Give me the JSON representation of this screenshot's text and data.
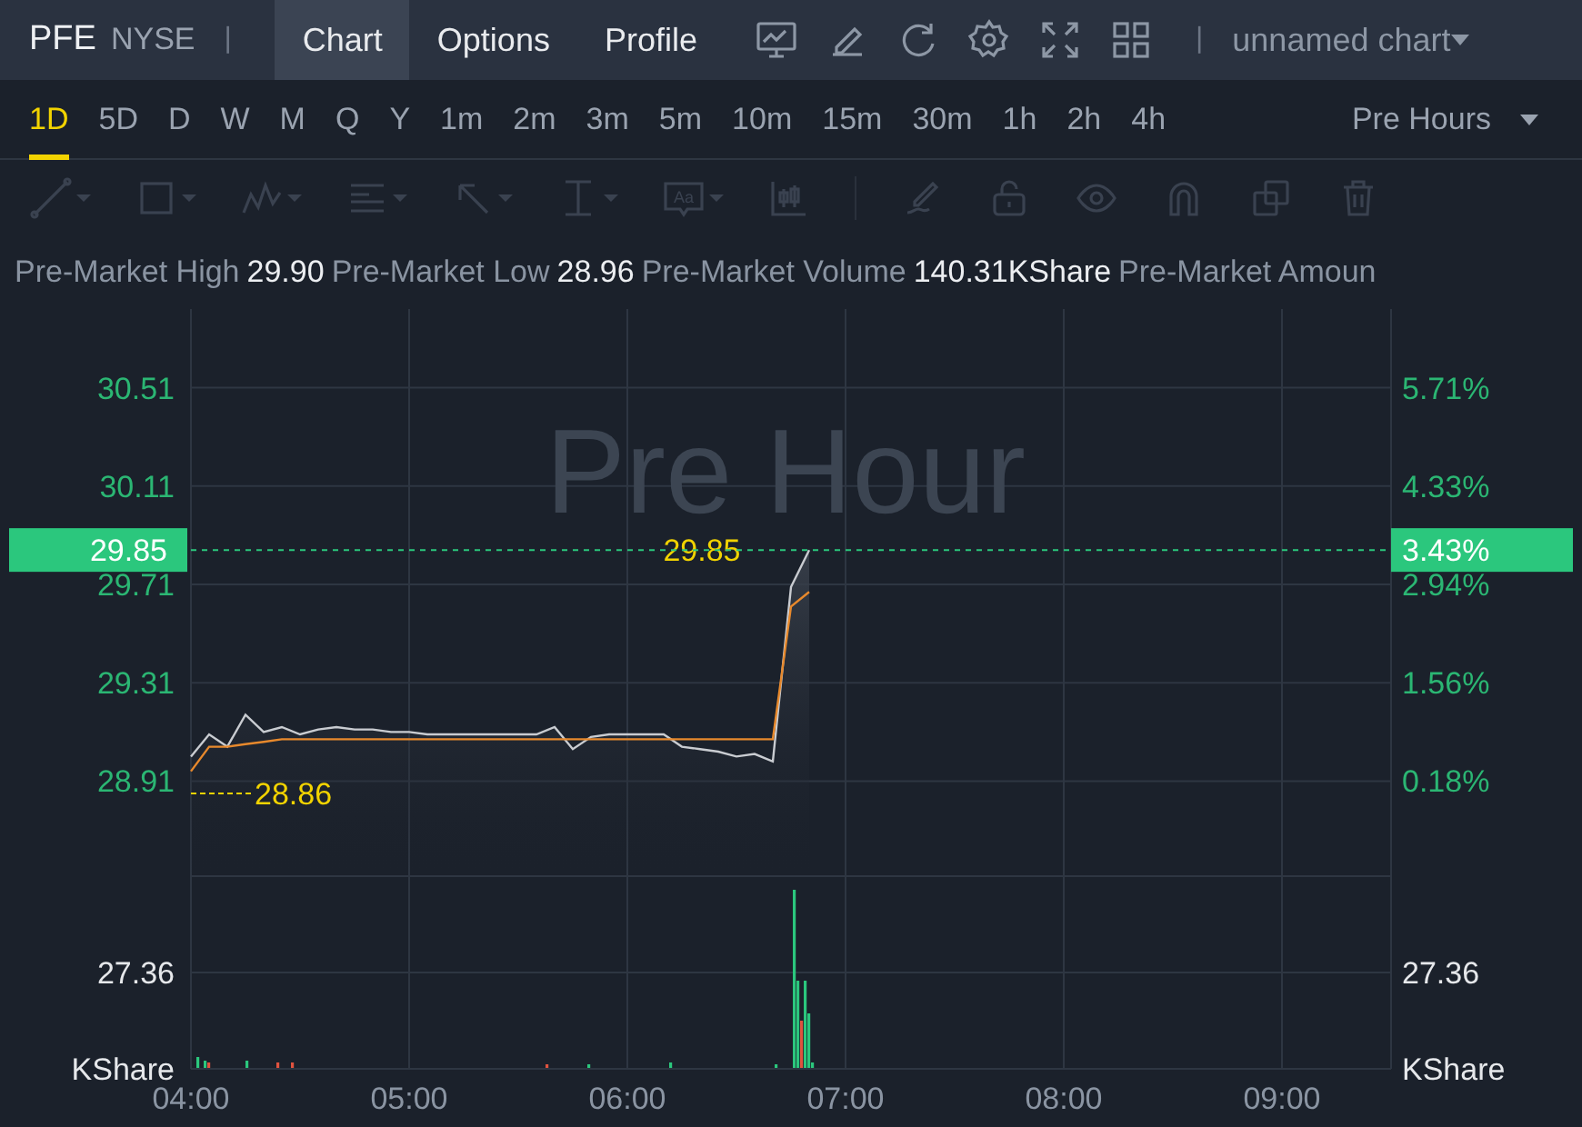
{
  "header": {
    "symbol": "PFE",
    "exchange": "NYSE",
    "separator": "|",
    "tabs": [
      {
        "label": "Chart",
        "selected": true
      },
      {
        "label": "Options",
        "selected": false
      },
      {
        "label": "Profile",
        "selected": false
      }
    ],
    "chart_name": "unnamed chart"
  },
  "timeframes": [
    {
      "label": "1D",
      "selected": true
    },
    {
      "label": "5D",
      "selected": false
    },
    {
      "label": "D",
      "selected": false
    },
    {
      "label": "W",
      "selected": false
    },
    {
      "label": "M",
      "selected": false
    },
    {
      "label": "Q",
      "selected": false
    },
    {
      "label": "Y",
      "selected": false
    },
    {
      "label": "1m",
      "selected": false
    },
    {
      "label": "2m",
      "selected": false
    },
    {
      "label": "3m",
      "selected": false
    },
    {
      "label": "5m",
      "selected": false
    },
    {
      "label": "10m",
      "selected": false
    },
    {
      "label": "15m",
      "selected": false
    },
    {
      "label": "30m",
      "selected": false
    },
    {
      "label": "1h",
      "selected": false
    },
    {
      "label": "2h",
      "selected": false
    },
    {
      "label": "4h",
      "selected": false
    }
  ],
  "session": "Pre Hours",
  "drawing_tools": [
    {
      "kind": "line",
      "disabled": true
    },
    {
      "kind": "rectangle",
      "disabled": true
    },
    {
      "kind": "pattern",
      "disabled": true
    },
    {
      "kind": "fib",
      "disabled": true
    },
    {
      "kind": "arrow",
      "disabled": true
    },
    {
      "kind": "measure",
      "disabled": true
    },
    {
      "kind": "text",
      "label": "Aa",
      "disabled": true
    },
    {
      "kind": "indicator",
      "disabled": true
    },
    {
      "kind": "pencil",
      "disabled": true
    },
    {
      "kind": "lock",
      "disabled": true
    },
    {
      "kind": "eye",
      "disabled": true
    },
    {
      "kind": "magnet",
      "disabled": true
    },
    {
      "kind": "layers",
      "disabled": true
    },
    {
      "kind": "trash",
      "disabled": true
    }
  ],
  "stats": [
    {
      "label": "Pre-Market High",
      "value": "29.90"
    },
    {
      "label": "Pre-Market Low",
      "value": "28.96"
    },
    {
      "label": "Pre-Market Volume",
      "value": "140.31KShare"
    },
    {
      "label": "Pre-Market Amoun"
    }
  ],
  "chart": {
    "watermark": "Pre Hour",
    "current_price": "29.85",
    "current_change": "3.43%",
    "price_marker": "29.85",
    "low_marker": "28.86",
    "right_ticks": [
      "5.71%",
      "4.33%",
      "2.94%",
      "1.56%",
      "0.18%"
    ],
    "volume": {
      "left_tick": "27.36",
      "left_unit": "KShare",
      "right_tick": "27.36",
      "right_unit": "KShare"
    },
    "chart_data": {
      "type": "line",
      "categories": [
        "04:00",
        null,
        null,
        null,
        null,
        null,
        null,
        null,
        null,
        null,
        null,
        null,
        "05:00",
        null,
        null,
        null,
        null,
        null,
        null,
        null,
        null,
        null,
        null,
        null,
        "06:00",
        null,
        null,
        null,
        null,
        null,
        null,
        null,
        null,
        null,
        null,
        null,
        "07:00",
        null,
        null,
        null,
        null,
        null,
        null,
        null,
        null,
        null,
        null,
        null,
        "08:00",
        null,
        null,
        null,
        null,
        null,
        null,
        null,
        null,
        null,
        null,
        null,
        "09:00",
        null,
        null,
        null,
        null,
        null,
        null
      ],
      "series": [
        {
          "color": "#c9ccd1",
          "values": [
            29.01,
            29.1,
            29.05,
            29.18,
            29.11,
            29.13,
            29.1,
            29.12,
            29.13,
            29.12,
            29.12,
            29.11,
            29.11,
            29.1,
            29.1,
            29.1,
            29.1,
            29.1,
            29.1,
            29.1,
            29.13,
            29.04,
            29.09,
            29.1,
            29.1,
            29.1,
            29.1,
            29.05,
            29.04,
            29.03,
            29.01,
            29.02,
            28.99,
            29.7,
            29.85,
            null,
            null,
            null,
            null,
            null,
            null,
            null,
            null,
            null,
            null,
            null,
            null,
            null,
            null,
            null,
            null,
            null,
            null,
            null,
            null,
            null,
            null,
            null,
            null,
            null,
            null,
            null,
            null,
            null,
            null,
            null,
            null
          ]
        },
        {
          "color": "#e8892c",
          "values": [
            28.95,
            29.05,
            29.05,
            29.06,
            29.07,
            29.08,
            29.08,
            29.08,
            29.08,
            29.08,
            29.08,
            29.08,
            29.08,
            29.08,
            29.08,
            29.08,
            29.08,
            29.08,
            29.08,
            29.08,
            29.08,
            29.08,
            29.08,
            29.08,
            29.08,
            29.08,
            29.08,
            29.08,
            29.08,
            29.08,
            29.08,
            29.08,
            29.08,
            29.62,
            29.68,
            null,
            null,
            null,
            null,
            null,
            null,
            null,
            null,
            null,
            null,
            null,
            null,
            null,
            null,
            null,
            null,
            null,
            null,
            null,
            null,
            null,
            null,
            null,
            null,
            null,
            null,
            null,
            null,
            null,
            null,
            null,
            null
          ]
        }
      ],
      "ylim": [
        27.74,
        30.83
      ],
      "grid": true,
      "yticks": [
        30.51,
        30.11,
        29.71,
        29.31,
        28.91
      ]
    }
  }
}
